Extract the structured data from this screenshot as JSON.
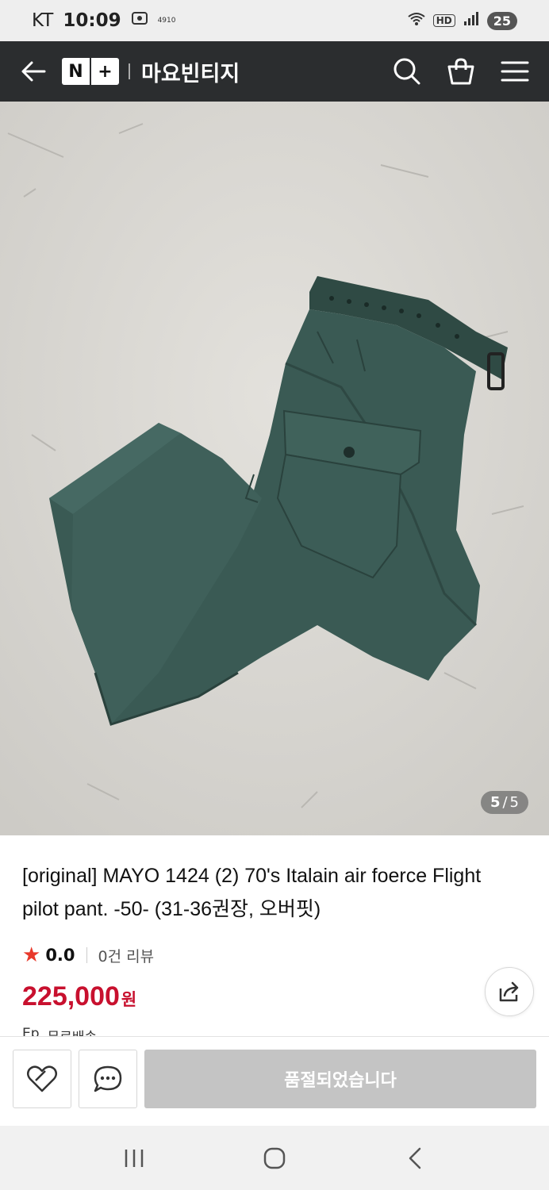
{
  "status_bar": {
    "carrier": "KT",
    "time": "10:09",
    "notif": "4910",
    "hd": "HD",
    "battery": "25"
  },
  "header": {
    "logo_left": "N",
    "logo_right": "+",
    "store_name": "마요빈티지"
  },
  "gallery": {
    "current": "5",
    "separator": "/",
    "total": "5"
  },
  "product": {
    "title": "[original] MAYO 1424 (2) 70's Italain air foerce Flight pilot pant. -50- (31-36권장, 오버핏)",
    "rating": "0.0",
    "review_count": "0건 리뷰",
    "price": "225,000",
    "currency": "원",
    "shipping_icon": "Ep",
    "shipping_text": "무료배송"
  },
  "actions": {
    "soldout_label": "품절되었습니다"
  },
  "colors": {
    "accent_red": "#c8102e",
    "star_red": "#e8392b",
    "header_bg": "#2b2d2f"
  }
}
